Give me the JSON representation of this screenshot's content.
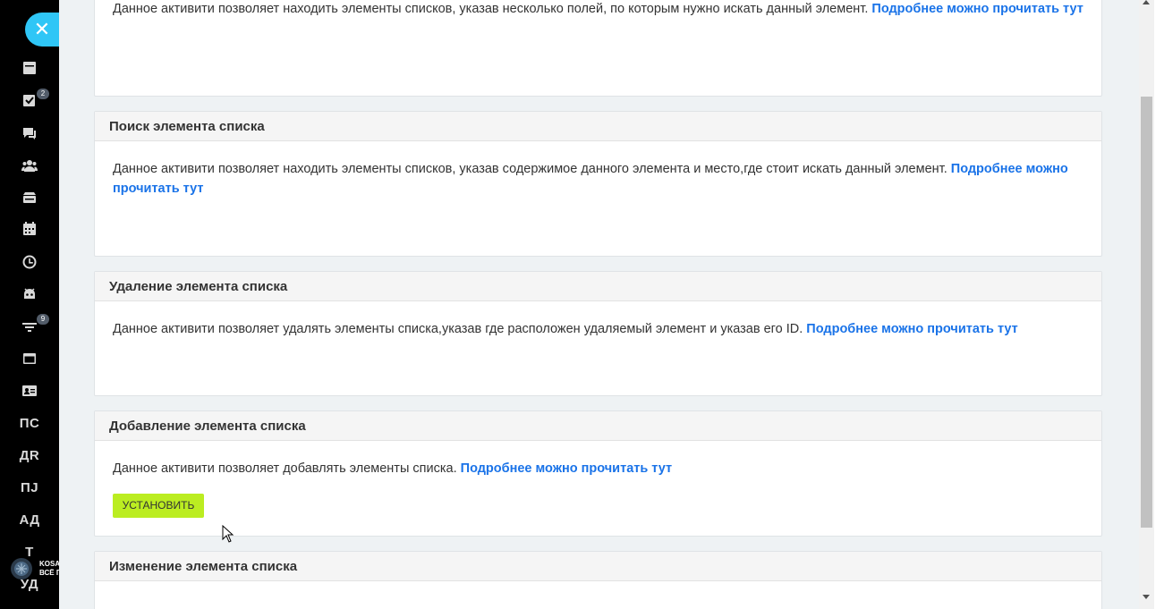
{
  "sidebar": {
    "close_symbol": "✕",
    "icons": [
      {
        "name": "news-icon",
        "badge": ""
      },
      {
        "name": "tasks-icon",
        "badge": "2"
      },
      {
        "name": "chat-icon",
        "badge": ""
      },
      {
        "name": "groups-icon",
        "badge": ""
      },
      {
        "name": "drive-icon",
        "badge": ""
      },
      {
        "name": "calendar-icon",
        "badge": ""
      },
      {
        "name": "clock-icon",
        "badge": ""
      },
      {
        "name": "robot-icon",
        "badge": ""
      },
      {
        "name": "filter-icon",
        "badge": "9"
      },
      {
        "name": "window-icon",
        "badge": ""
      },
      {
        "name": "contact-card-icon",
        "badge": ""
      }
    ],
    "text_items": [
      "ПС",
      "ДR",
      "ПJ",
      "АД",
      "Т",
      "УД"
    ],
    "logo_text_1": "KOSA",
    "logo_text_2": "ВСЁ П"
  },
  "cards": [
    {
      "title": "",
      "text": "Данное активити позволяет находить элементы списков, указав несколько полей, по которым нужно искать данный элемент.",
      "link": "Подробнее можно прочитать тут"
    },
    {
      "title": "Поиск элемента списка",
      "text": "Данное активити позволяет находить элементы списков, указав содержимое данного элемента и место,где стоит искать данный элемент.",
      "link": "Подробнее можно прочитать тут"
    },
    {
      "title": "Удаление элемента списка",
      "text": "Данное активити позволяет удалять элементы списка,указав где расположен удаляемый элемент и указав его ID.",
      "link": "Подробнее можно прочитать тут"
    },
    {
      "title": "Добавление элемента списка",
      "text": "Данное активити позволяет добавлять элементы списка.",
      "link": "Подробнее можно прочитать тут",
      "button": "УСТАНОВИТЬ"
    },
    {
      "title": "Изменение элемента списка",
      "text": "",
      "link": ""
    }
  ],
  "colors": {
    "accent": "#2fc6f6",
    "link": "#1a73e8",
    "install_button": "#bbed21"
  }
}
